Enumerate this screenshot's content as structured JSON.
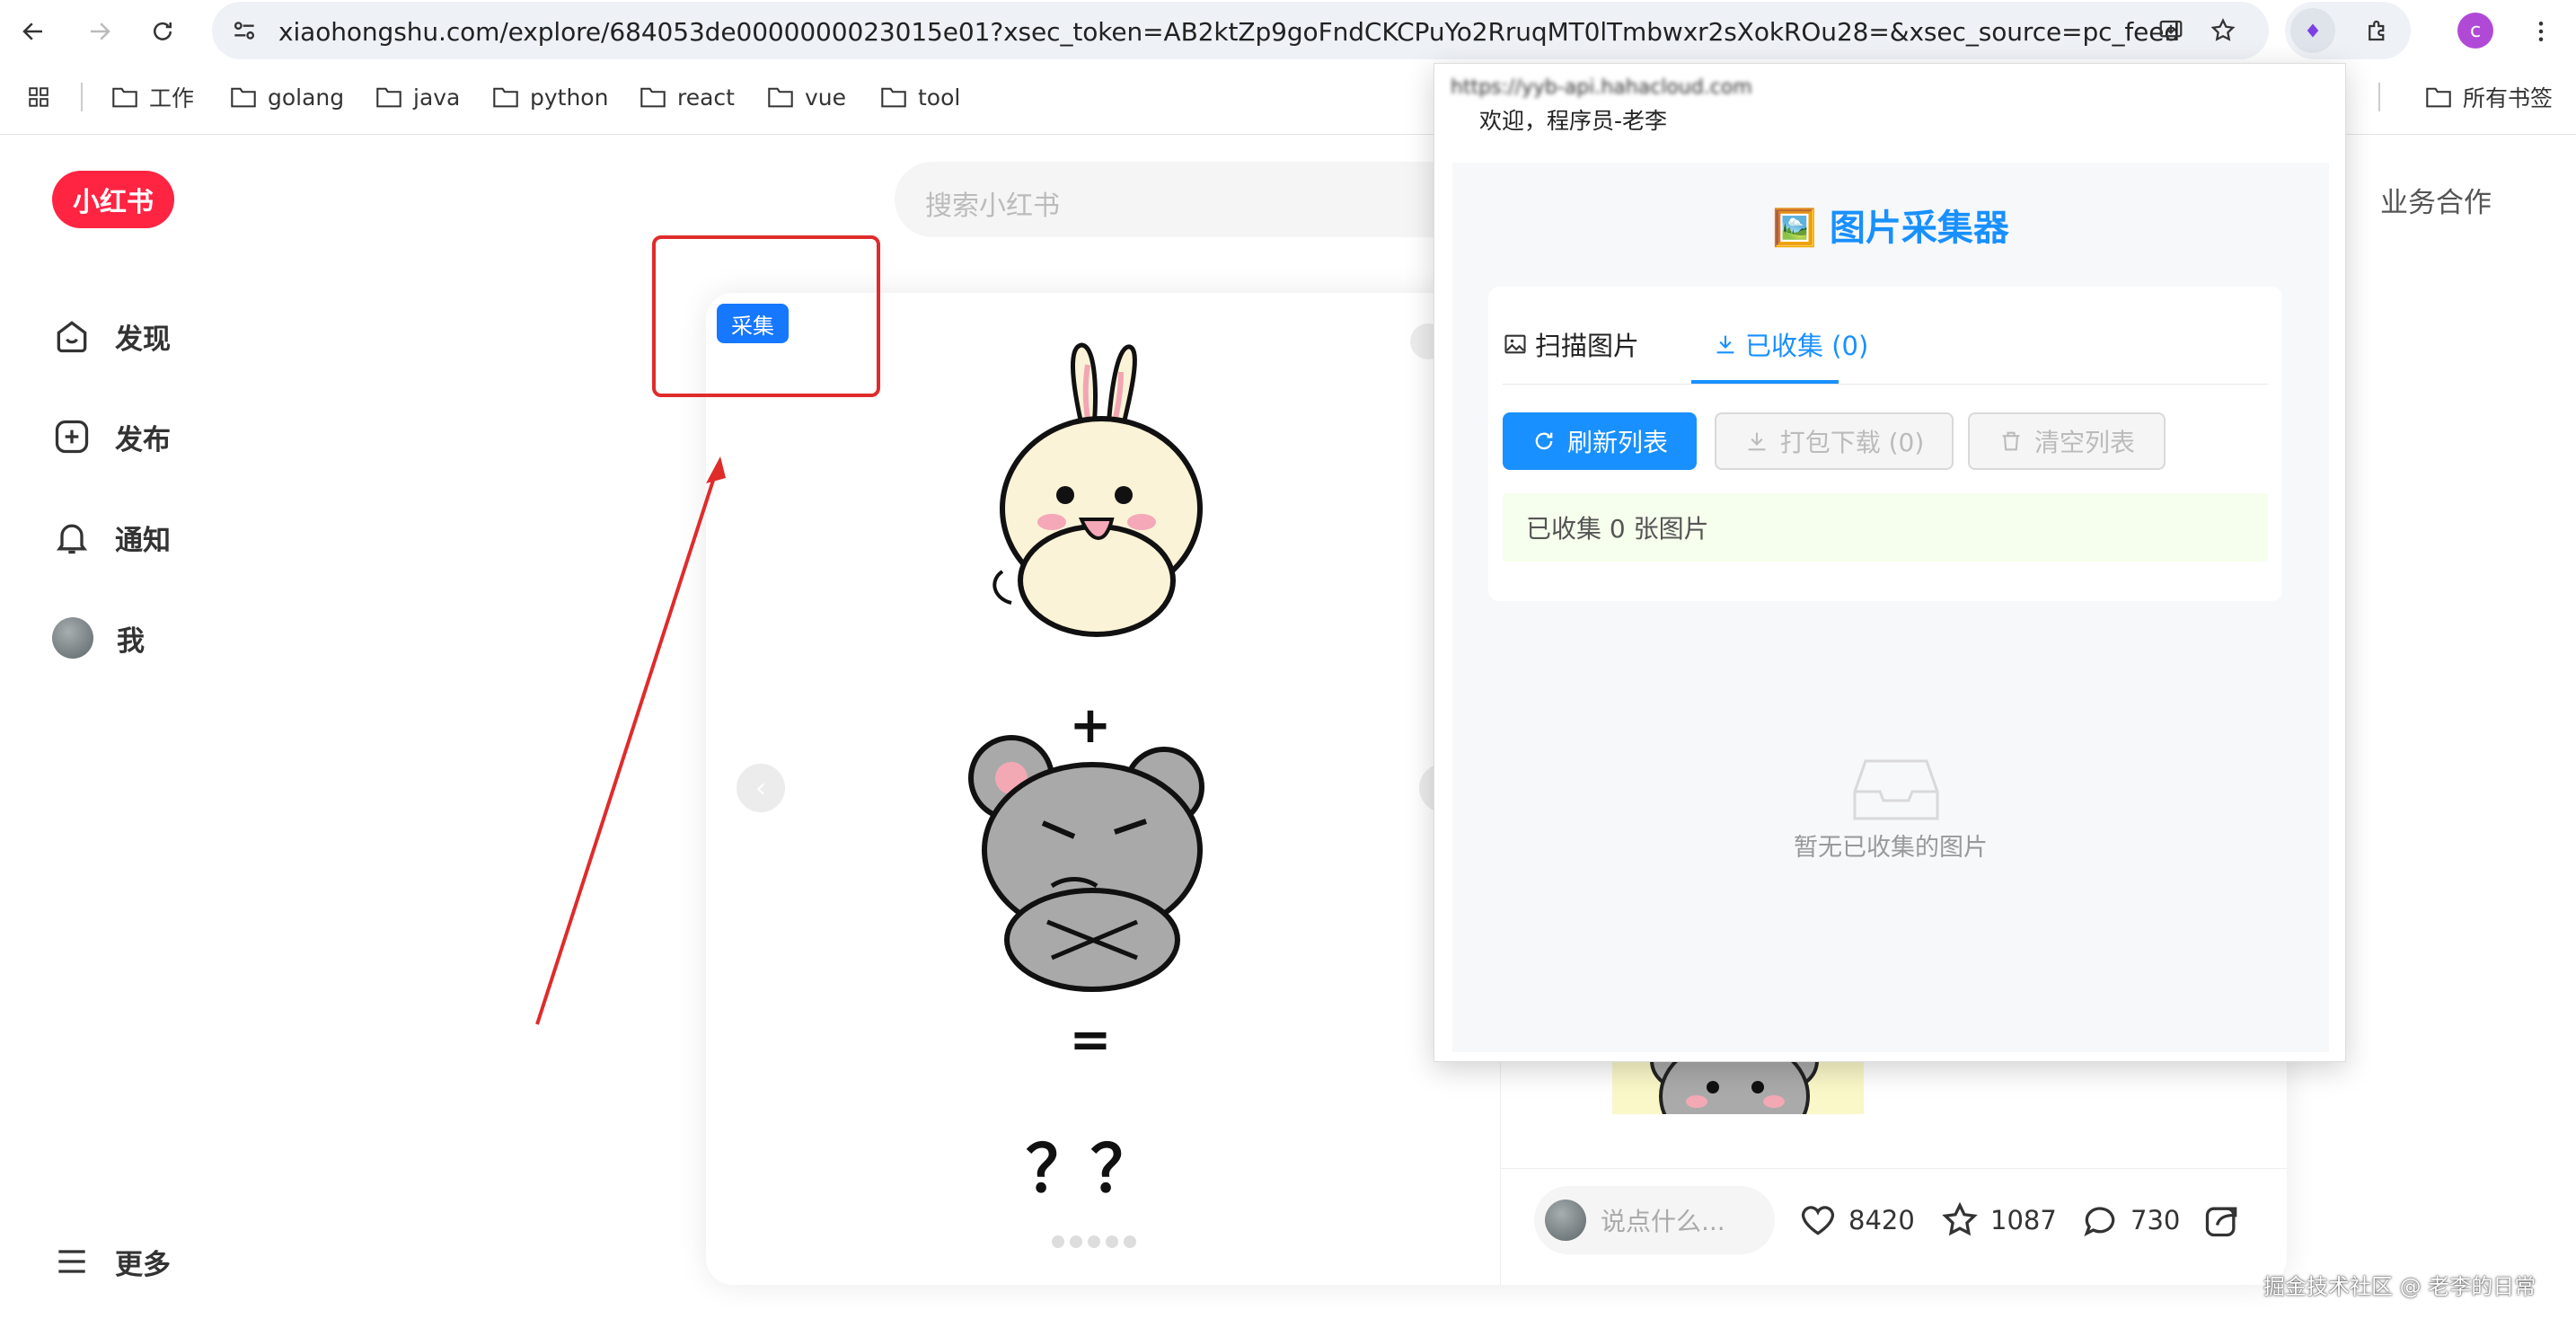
{
  "browser": {
    "url": "xiaohongshu.com/explore/684053de0000000023015e01?xsec_token=AB2ktZp9goFndCKCPuYo2RruqMT0lTmbwxr2sXokROu28=&xsec_source=pc_feed",
    "profile_initial": "c",
    "bookmarks": [
      "工作",
      "golang",
      "java",
      "python",
      "react",
      "vue",
      "tool"
    ],
    "all_bookmarks": "所有书签"
  },
  "site": {
    "logo": "小红书",
    "search_placeholder": "搜索小红书",
    "business_link": "业务合作",
    "nav": [
      {
        "label": "发现",
        "icon": "discover-icon"
      },
      {
        "label": "发布",
        "icon": "publish-icon"
      },
      {
        "label": "通知",
        "icon": "bell-icon"
      },
      {
        "label": "我",
        "icon": "avatar"
      }
    ],
    "more": "更多"
  },
  "note": {
    "collect_tag": "采集",
    "comment_placeholder": "说点什么...",
    "likes": "8420",
    "stars": "1087",
    "comments": "730",
    "image_text": {
      "plus": "+",
      "equals": "=",
      "question": "？？"
    }
  },
  "extension": {
    "host": "https://yyb-api.hahacloud.com",
    "welcome": "欢迎，程序员-老李",
    "title": "🖼️ 图片采集器",
    "tabs": [
      "扫描图片",
      "已收集 (0)"
    ],
    "active_tab_index": 1,
    "buttons": {
      "refresh": "刷新列表",
      "download": "打包下载 (0)",
      "clear": "清空列表"
    },
    "info": "已收集 0 张图片",
    "empty": "暂无已收集的图片",
    "accent": "#1890ff"
  },
  "watermark": "掘金技术社区 @ 老李的日常"
}
